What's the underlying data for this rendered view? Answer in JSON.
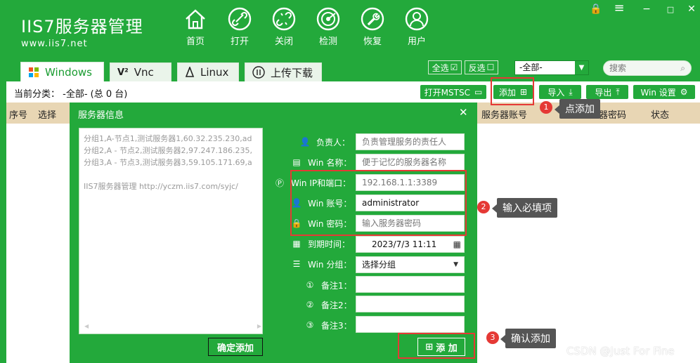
{
  "app": {
    "title": "IIS7服务器管理",
    "url": "www.iis7.net"
  },
  "nav": [
    {
      "label": "首页",
      "icon": "home-icon"
    },
    {
      "label": "打开",
      "icon": "link-icon"
    },
    {
      "label": "关闭",
      "icon": "unlink-icon"
    },
    {
      "label": "检测",
      "icon": "radar-icon"
    },
    {
      "label": "恢复",
      "icon": "wrench-icon"
    },
    {
      "label": "用户",
      "icon": "user-icon"
    }
  ],
  "window_controls": {
    "lock": "🔒",
    "menu": "≡",
    "minimize": "−",
    "maximize": "□",
    "close": "✕"
  },
  "tabs": [
    {
      "label": "Windows",
      "icon": "windows-icon"
    },
    {
      "label": "Vnc",
      "icon": "vnc-icon"
    },
    {
      "label": "Linux",
      "icon": "linux-icon"
    },
    {
      "label": "上传下载",
      "icon": "transfer-icon"
    }
  ],
  "toolbar": {
    "select_all": "全选",
    "invert": "反选",
    "category_value": "-全部-",
    "search_placeholder": "搜索",
    "current_category": "当前分类：  -全部-  (总 0 台)",
    "open_mstsc": "打开MSTSC",
    "add": "添加",
    "import": "导入",
    "export": "导出",
    "win_settings": "Win  设置"
  },
  "table": {
    "headers": [
      "序号",
      "选择",
      "服务器账号",
      "服务器密码",
      "状态"
    ]
  },
  "dialog": {
    "title": "服务器信息",
    "close": "✕",
    "textarea_lines": "分组1,A-节点1,测试服务器1,60.32.235.230,ad\n分组2,A - 节点2,测试服务器2,97.247.186.235,\n分组3,A - 节点3,测试服务器3,59.105.171.69,a\n\nIIS7服务器管理 http://yczm.iis7.com/syjc/",
    "confirm_add": "确定添加",
    "fields": [
      {
        "label": "负责人：",
        "value": "负责管理服务的责任人"
      },
      {
        "label": "Win 名称：",
        "value": "便于记忆的服务器名称"
      },
      {
        "label": "Win IP和端口：",
        "value": "192.168.1.1:3389"
      },
      {
        "label": "Win 账号：",
        "value": "administrator"
      },
      {
        "label": "Win 密码：",
        "value": "输入服务器密码"
      },
      {
        "label": "到期时间：",
        "value": "2023/7/3 11:11"
      },
      {
        "label": "Win 分组：",
        "value": "选择分组"
      },
      {
        "label": "备注1：",
        "value": ""
      },
      {
        "label": "备注2：",
        "value": ""
      },
      {
        "label": "备注3：",
        "value": ""
      }
    ],
    "add_button": "添 加"
  },
  "annotations": [
    {
      "num": "1",
      "text": "点添加"
    },
    {
      "num": "2",
      "text": "输入必填项"
    },
    {
      "num": "3",
      "text": "确认添加"
    }
  ],
  "watermark": "CSDN @Just For Fine",
  "colors": {
    "brand_green": "#23a93b",
    "header_tan": "#e8d6b4",
    "annotation_red": "#e53935"
  }
}
